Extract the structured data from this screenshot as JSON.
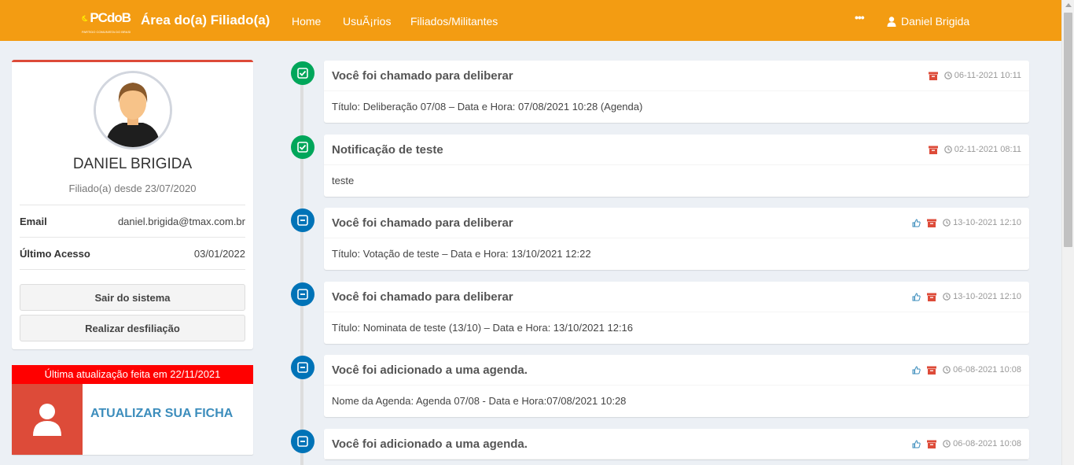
{
  "navbar": {
    "logo_text": "PCdoB",
    "logo_subtitle": "PARTIDO COMUNISTA DO BRASIL",
    "brand": "Área do(a) Filiado(a)",
    "links": [
      "Home",
      "UsuÃ¡rios",
      "Filiados/Militantes"
    ],
    "dots": "•••",
    "user_name": "Daniel Brigida",
    "color": "#f39c12"
  },
  "profile": {
    "name": "DANIEL BRIGIDA",
    "since": "Filiado(a) desde 23/07/2020",
    "email_label": "Email",
    "email_value": "daniel.brigida@tmax.com.br",
    "last_access_label": "Último Acesso",
    "last_access_value": "03/01/2022",
    "logout_button": "Sair do sistema",
    "unaffiliate_button": "Realizar desfiliação"
  },
  "update": {
    "header": "Última atualização feita em 22/11/2021",
    "action": "ATUALIZAR SUA FICHA"
  },
  "timeline": [
    {
      "icon": "check-square-icon",
      "status": "green",
      "title": "Você foi chamado para deliberar",
      "has_like": false,
      "time": "06-11-2021 10:11",
      "body": "Título: Deliberação 07/08 – Data e Hora: 07/08/2021 10:28 (Agenda)"
    },
    {
      "icon": "check-square-icon",
      "status": "green",
      "title": "Notificação de teste",
      "has_like": false,
      "time": "02-11-2021 08:11",
      "body": "teste"
    },
    {
      "icon": "minus-square-icon",
      "status": "blue",
      "title": "Você foi chamado para deliberar",
      "has_like": true,
      "time": "13-10-2021 12:10",
      "body": "Título: Votação de teste – Data e Hora: 13/10/2021 12:22"
    },
    {
      "icon": "minus-square-icon",
      "status": "blue",
      "title": "Você foi chamado para deliberar",
      "has_like": true,
      "time": "13-10-2021 12:10",
      "body": "Título: Nominata de teste (13/10) – Data e Hora: 13/10/2021 12:16"
    },
    {
      "icon": "minus-square-icon",
      "status": "blue",
      "title": "Você foi adicionado a uma agenda.",
      "has_like": true,
      "time": "06-08-2021 10:08",
      "body": "Nome da Agenda: Agenda 07/08 - Data e Hora:07/08/2021 10:28"
    },
    {
      "icon": "minus-square-icon",
      "status": "blue",
      "title": "Você foi adicionado a uma agenda.",
      "has_like": true,
      "time": "06-08-2021 10:08",
      "body": ""
    }
  ]
}
